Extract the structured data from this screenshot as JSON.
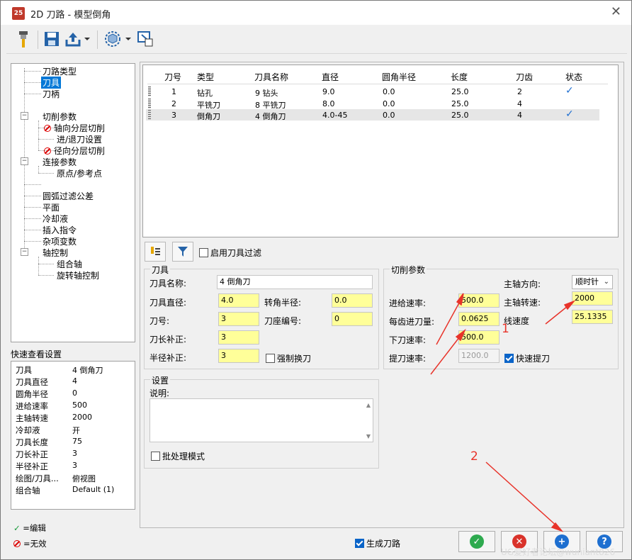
{
  "window": {
    "title": "2D 刀路 - 模型倒角",
    "logo_text": "25",
    "close_glyph": "✕"
  },
  "toolbar": {
    "buttons": [
      "tool-icon",
      "save-icon",
      "export-icon",
      "dropdown",
      "view-cube-icon",
      "dropdown",
      "select-icon"
    ]
  },
  "tree": {
    "items": [
      {
        "label": "刀路类型"
      },
      {
        "label": "刀具"
      },
      {
        "label": "刀柄"
      },
      {
        "label": "切削参数"
      },
      {
        "label": "轴向分层切削"
      },
      {
        "label": "进/退刀设置"
      },
      {
        "label": "径向分层切削"
      },
      {
        "label": "连接参数"
      },
      {
        "label": "原点/参考点"
      },
      {
        "label": "圆弧过滤公差"
      },
      {
        "label": "平面"
      },
      {
        "label": "冷却液"
      },
      {
        "label": "插入指令"
      },
      {
        "label": "杂项变数"
      },
      {
        "label": "轴控制"
      },
      {
        "label": "组合轴"
      },
      {
        "label": "旋转轴控制"
      }
    ],
    "expander": "−"
  },
  "quick_view": {
    "title": "快速查看设置",
    "rows": [
      {
        "k": "刀具",
        "v": "4 倒角刀"
      },
      {
        "k": "刀具直径",
        "v": "4"
      },
      {
        "k": "圆角半径",
        "v": "0"
      },
      {
        "k": "进给速率",
        "v": "500"
      },
      {
        "k": "主轴转速",
        "v": "2000"
      },
      {
        "k": "冷却液",
        "v": "开"
      },
      {
        "k": "刀具长度",
        "v": "75"
      },
      {
        "k": "刀长补正",
        "v": "3"
      },
      {
        "k": "半径补正",
        "v": "3"
      },
      {
        "k": "绘图/刀具...",
        "v": "俯视图"
      },
      {
        "k": "组合轴",
        "v": "Default (1)"
      }
    ]
  },
  "legend": {
    "edit_mark": "✓",
    "edit": "=编辑",
    "invalid": "=无效"
  },
  "tool_table": {
    "headers": [
      "刀号",
      "类型",
      "刀具名称",
      "直径",
      "圆角半径",
      "长度",
      "刀齿",
      "状态"
    ],
    "rows": [
      {
        "no": "1",
        "type": "钻孔",
        "name": "9 钻头",
        "dia": "9.0",
        "corner": "0.0",
        "len": "25.0",
        "flutes": "2",
        "status": "✓"
      },
      {
        "no": "2",
        "type": "平铣刀",
        "name": "8 平铣刀",
        "dia": "8.0",
        "corner": "0.0",
        "len": "25.0",
        "flutes": "4",
        "status": ""
      },
      {
        "no": "3",
        "type": "倒角刀",
        "name": "4 倒角刀",
        "dia": "4.0-45",
        "corner": "0.0",
        "len": "25.0",
        "flutes": "4",
        "status": "✓"
      }
    ]
  },
  "filter": {
    "label": "启用刀具过滤"
  },
  "tool_group": {
    "title": "刀具",
    "name_label": "刀具名称:",
    "name": "4 倒角刀",
    "dia_label": "刀具直径:",
    "dia": "4.0",
    "corner_label": "转角半径:",
    "corner": "0.0",
    "no_label": "刀号:",
    "no": "3",
    "holder_label": "刀座编号:",
    "holder": "0",
    "len_comp_label": "刀长补正:",
    "len_comp": "3",
    "rad_comp_label": "半径补正:",
    "rad_comp": "3",
    "force_change_label": "强制换刀"
  },
  "cut_group": {
    "title": "切削参数",
    "spindle_dir_label": "主轴方向:",
    "spindle_dir": "顺时针",
    "feed_label": "进给速率:",
    "feed": "500.0",
    "spindle_speed_label": "主轴转速:",
    "spindle_speed": "2000",
    "fpt_label": "每齿进刀量:",
    "fpt": "0.0625",
    "surface_speed_label": "线速度",
    "surface_speed": "25.1335",
    "plunge_label": "下刀速率:",
    "plunge": "500.0",
    "retract_label": "提刀速率:",
    "retract": "1200.0",
    "rapid_retract_label": "快速提刀"
  },
  "settings_group": {
    "title": "设置",
    "desc_label": "说明:",
    "batch_label": "批处理模式"
  },
  "bottom": {
    "generate_label": "生成刀路"
  },
  "annotations": {
    "one": "1",
    "two": "2"
  },
  "watermark": "UG爱好者论坛@wuniant826"
}
